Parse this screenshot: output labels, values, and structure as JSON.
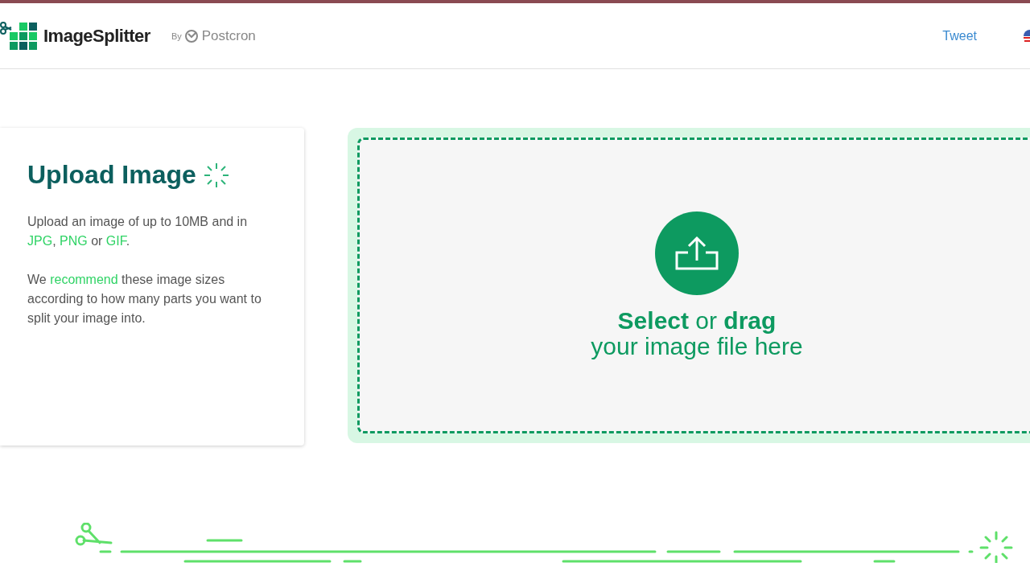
{
  "header": {
    "brand": "ImageSplitter",
    "by": "By",
    "partner": "Postcron",
    "tweet": "Tweet"
  },
  "upload_card": {
    "title": "Upload Image",
    "paragraphs": [
      [
        {
          "text": "Upload an image of up to 10MB and in ",
          "kind": "plain"
        },
        {
          "text": "JPG",
          "kind": "link"
        },
        {
          "text": ", ",
          "kind": "plain"
        },
        {
          "text": "PNG",
          "kind": "link"
        },
        {
          "text": " or ",
          "kind": "plain"
        },
        {
          "text": "GIF",
          "kind": "link"
        },
        {
          "text": ".",
          "kind": "plain"
        }
      ],
      [
        {
          "text": "We ",
          "kind": "plain"
        },
        {
          "text": "recommend",
          "kind": "link"
        },
        {
          "text": " these image sizes according to how many parts you want to split your image into.",
          "kind": "plain"
        }
      ]
    ]
  },
  "dropzone": {
    "line1": "**Select** or **drag**",
    "line2": "your image file here"
  }
}
